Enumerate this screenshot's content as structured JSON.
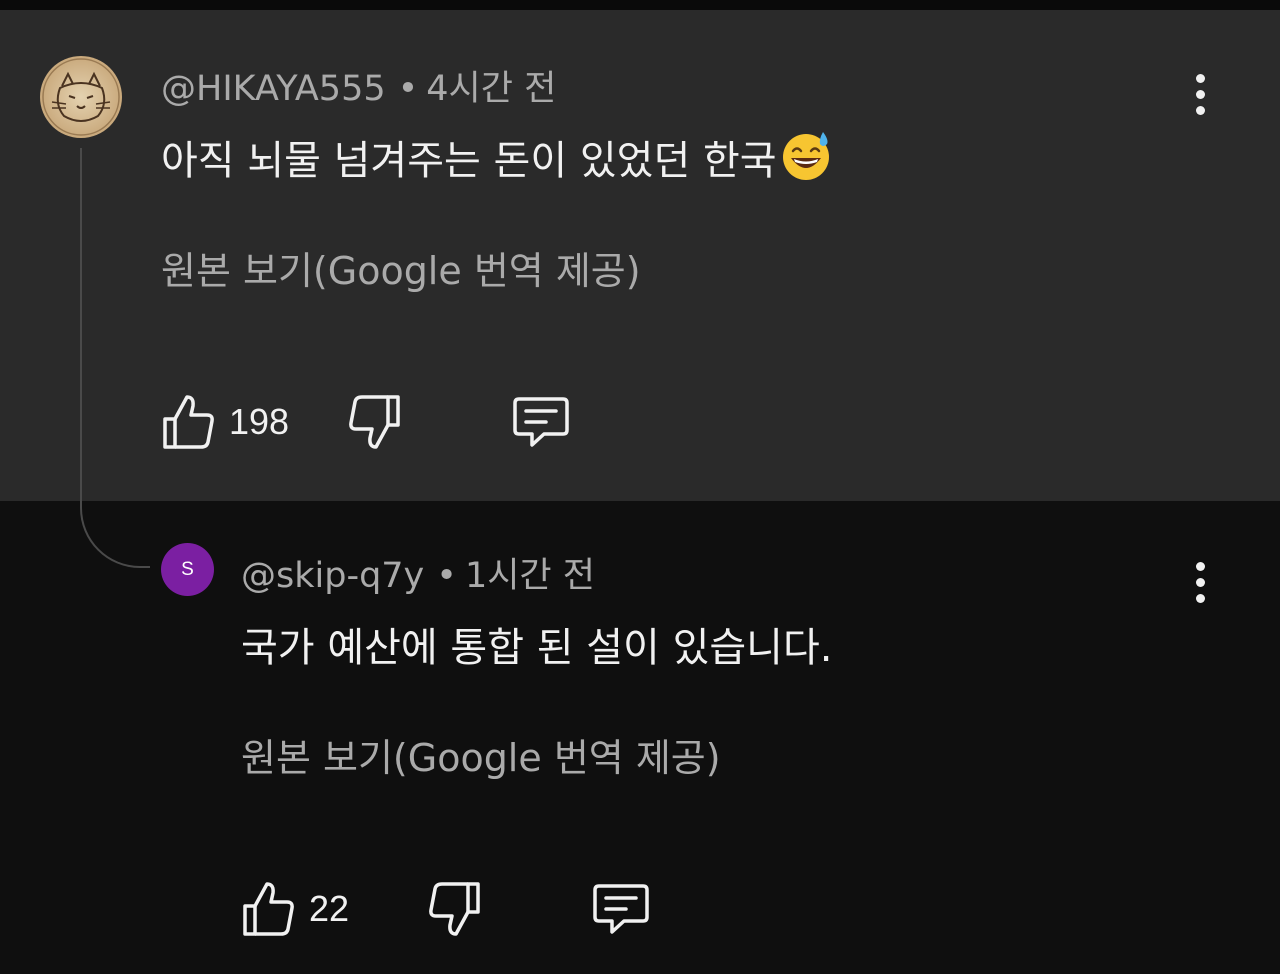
{
  "comments": [
    {
      "author": "@HIKAYA555",
      "time": "4시간 전",
      "text": "아직 뇌물 넘겨주는 돈이 있었던 한국",
      "emoji": "sweat-smile-emoji",
      "translate_link": "원본 보기(Google 번역 제공)",
      "likes": "198",
      "avatar": "cat-face-avatar"
    },
    {
      "author": "@skip-q7y",
      "time": "1시간 전",
      "text": "국가 예산에 통합 된 설이 있습니다.",
      "translate_link": "원본 보기(Google 번역 제공)",
      "likes": "22",
      "avatar_letter": "S",
      "avatar_color": "#7b1fa2"
    }
  ],
  "colors": {
    "background": "#0f0f0f",
    "highlight": "#2a2a2a",
    "text": "#f1f1f1",
    "secondary_text": "#aaaaaa"
  }
}
